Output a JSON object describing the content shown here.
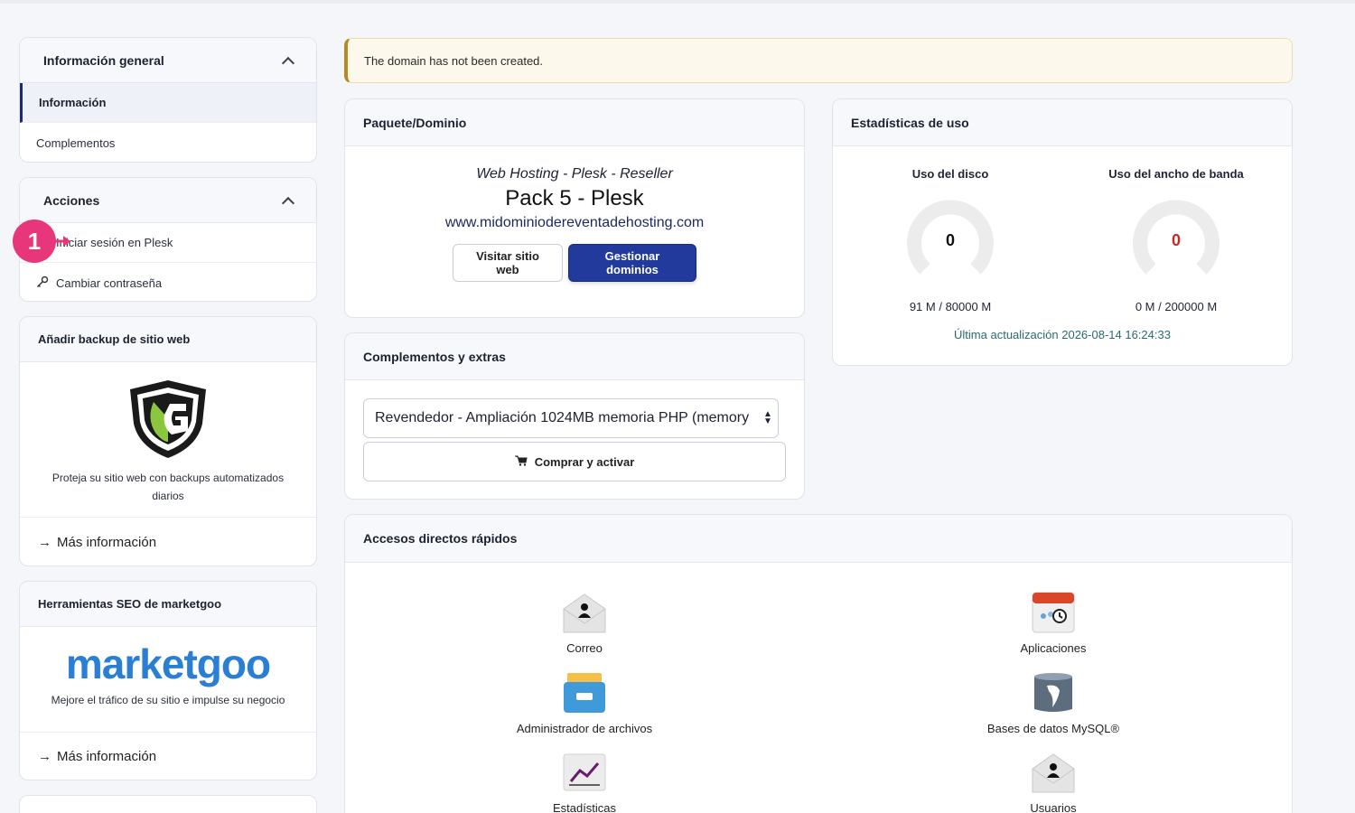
{
  "alert": {
    "message": "The domain has not been created."
  },
  "sidebar": {
    "general": {
      "title": "Información general",
      "items": [
        {
          "label": "Información",
          "active": true
        },
        {
          "label": "Complementos",
          "active": false
        }
      ]
    },
    "actions": {
      "title": "Acciones",
      "items": [
        {
          "label": "Iniciar sesión en Plesk",
          "icon": "login-arrow-icon"
        },
        {
          "label": "Cambiar contraseña",
          "icon": "key-icon"
        }
      ]
    },
    "backup": {
      "title": "Añadir backup de sitio web",
      "description": "Proteja su sitio web con backups automatizados diarios",
      "link": "Más información"
    },
    "seo": {
      "title": "Herramientas SEO de marketgoo",
      "logo_text": "marketgoo",
      "description": "Mejore el tráfico de su sitio e impulse su negocio",
      "link": "Más información"
    }
  },
  "package": {
    "title": "Paquete/Dominio",
    "type": "Web Hosting - Plesk - Reseller",
    "name": "Pack 5 - Plesk",
    "domain": "www.midominiodereventadehosting.com",
    "visit_label": "Visitar sitio web",
    "manage_label": "Gestionar dominios"
  },
  "usage": {
    "title": "Estadísticas de uso",
    "disk": {
      "label": "Uso del disco",
      "value": "0",
      "detail": "91 M / 80000 M",
      "color": "#111111",
      "fraction": 0.001
    },
    "bandwidth": {
      "label": "Uso del ancho de banda",
      "value": "0",
      "detail": "0 M / 200000 M",
      "color": "#c62828",
      "fraction": 0
    },
    "updated": "Última actualización 2026-08-14 16:24:33"
  },
  "addons": {
    "title": "Complementos y extras",
    "selected": "Revendedor - Ampliación 1024MB memoria PHP (memory",
    "buy_label": "Comprar y activar"
  },
  "shortcuts": {
    "title": "Accesos directos rápidos",
    "items": [
      {
        "label": "Correo",
        "icon": "mail-icon"
      },
      {
        "label": "Aplicaciones",
        "icon": "applications-icon"
      },
      {
        "label": "Administrador de archivos",
        "icon": "file-manager-icon"
      },
      {
        "label": "Bases de datos MySQL®",
        "icon": "mysql-database-icon"
      },
      {
        "label": "Estadísticas",
        "icon": "statistics-icon"
      },
      {
        "label": "Usuarios",
        "icon": "users-icon"
      }
    ]
  },
  "annotation": {
    "number": "1",
    "color": "#e8367a"
  },
  "colors": {
    "primary": "#223a9c",
    "alert_border": "#b88a23",
    "timestamp": "#2b6a70"
  }
}
